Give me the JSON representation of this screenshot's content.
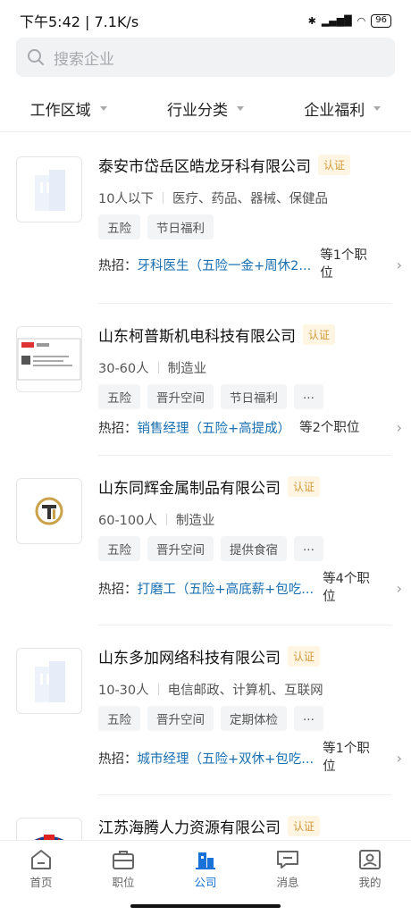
{
  "status_bar": {
    "time_speed": "下午5:42 | 7.1K/s",
    "battery": "96"
  },
  "search": {
    "placeholder": "搜索企业"
  },
  "filters": [
    "工作区域",
    "行业分类",
    "企业福利"
  ],
  "companies": [
    {
      "name": "泰安市岱岳区皓龙牙科有限公司",
      "verified": "认证",
      "size": "10人以下",
      "industry": "医疗、药品、器械、保健品",
      "tags": [
        "五险",
        "节日福利"
      ],
      "hot_label": "热招：",
      "hot_job": "牙科医生（五险一金+周休2...",
      "hot_count": "等1个职位"
    },
    {
      "name": "山东柯普斯机电科技有限公司",
      "verified": "认证",
      "size": "30-60人",
      "industry": "制造业",
      "tags": [
        "五险",
        "晋升空间",
        "节日福利",
        "..."
      ],
      "hot_label": "热招：",
      "hot_job": "销售经理（五险+高提成）",
      "hot_count": "等2个职位"
    },
    {
      "name": "山东同辉金属制品有限公司",
      "verified": "认证",
      "size": "60-100人",
      "industry": "制造业",
      "tags": [
        "五险",
        "晋升空间",
        "提供食宿",
        "..."
      ],
      "hot_label": "热招：",
      "hot_job": "打磨工（五险+高底薪+包吃...",
      "hot_count": "等4个职位"
    },
    {
      "name": "山东多加网络科技有限公司",
      "verified": "认证",
      "size": "10-30人",
      "industry": "电信邮政、计算机、互联网",
      "tags": [
        "五险",
        "晋升空间",
        "定期体检",
        "..."
      ],
      "hot_label": "热招：",
      "hot_job": "城市经理（五险+双休+包吃...",
      "hot_count": "等1个职位"
    },
    {
      "name": "江苏海腾人力资源有限公司",
      "verified": "认证"
    }
  ],
  "tabs": [
    {
      "label": "首页",
      "icon": "home-icon"
    },
    {
      "label": "职位",
      "icon": "briefcase-icon"
    },
    {
      "label": "公司",
      "icon": "building-icon",
      "active": true
    },
    {
      "label": "消息",
      "icon": "message-icon"
    },
    {
      "label": "我的",
      "icon": "profile-icon"
    }
  ],
  "colors": {
    "accent": "#1a72d8",
    "link": "#1a6fb0",
    "verify_bg": "#fff5e2",
    "verify_text": "#d39a3a"
  }
}
